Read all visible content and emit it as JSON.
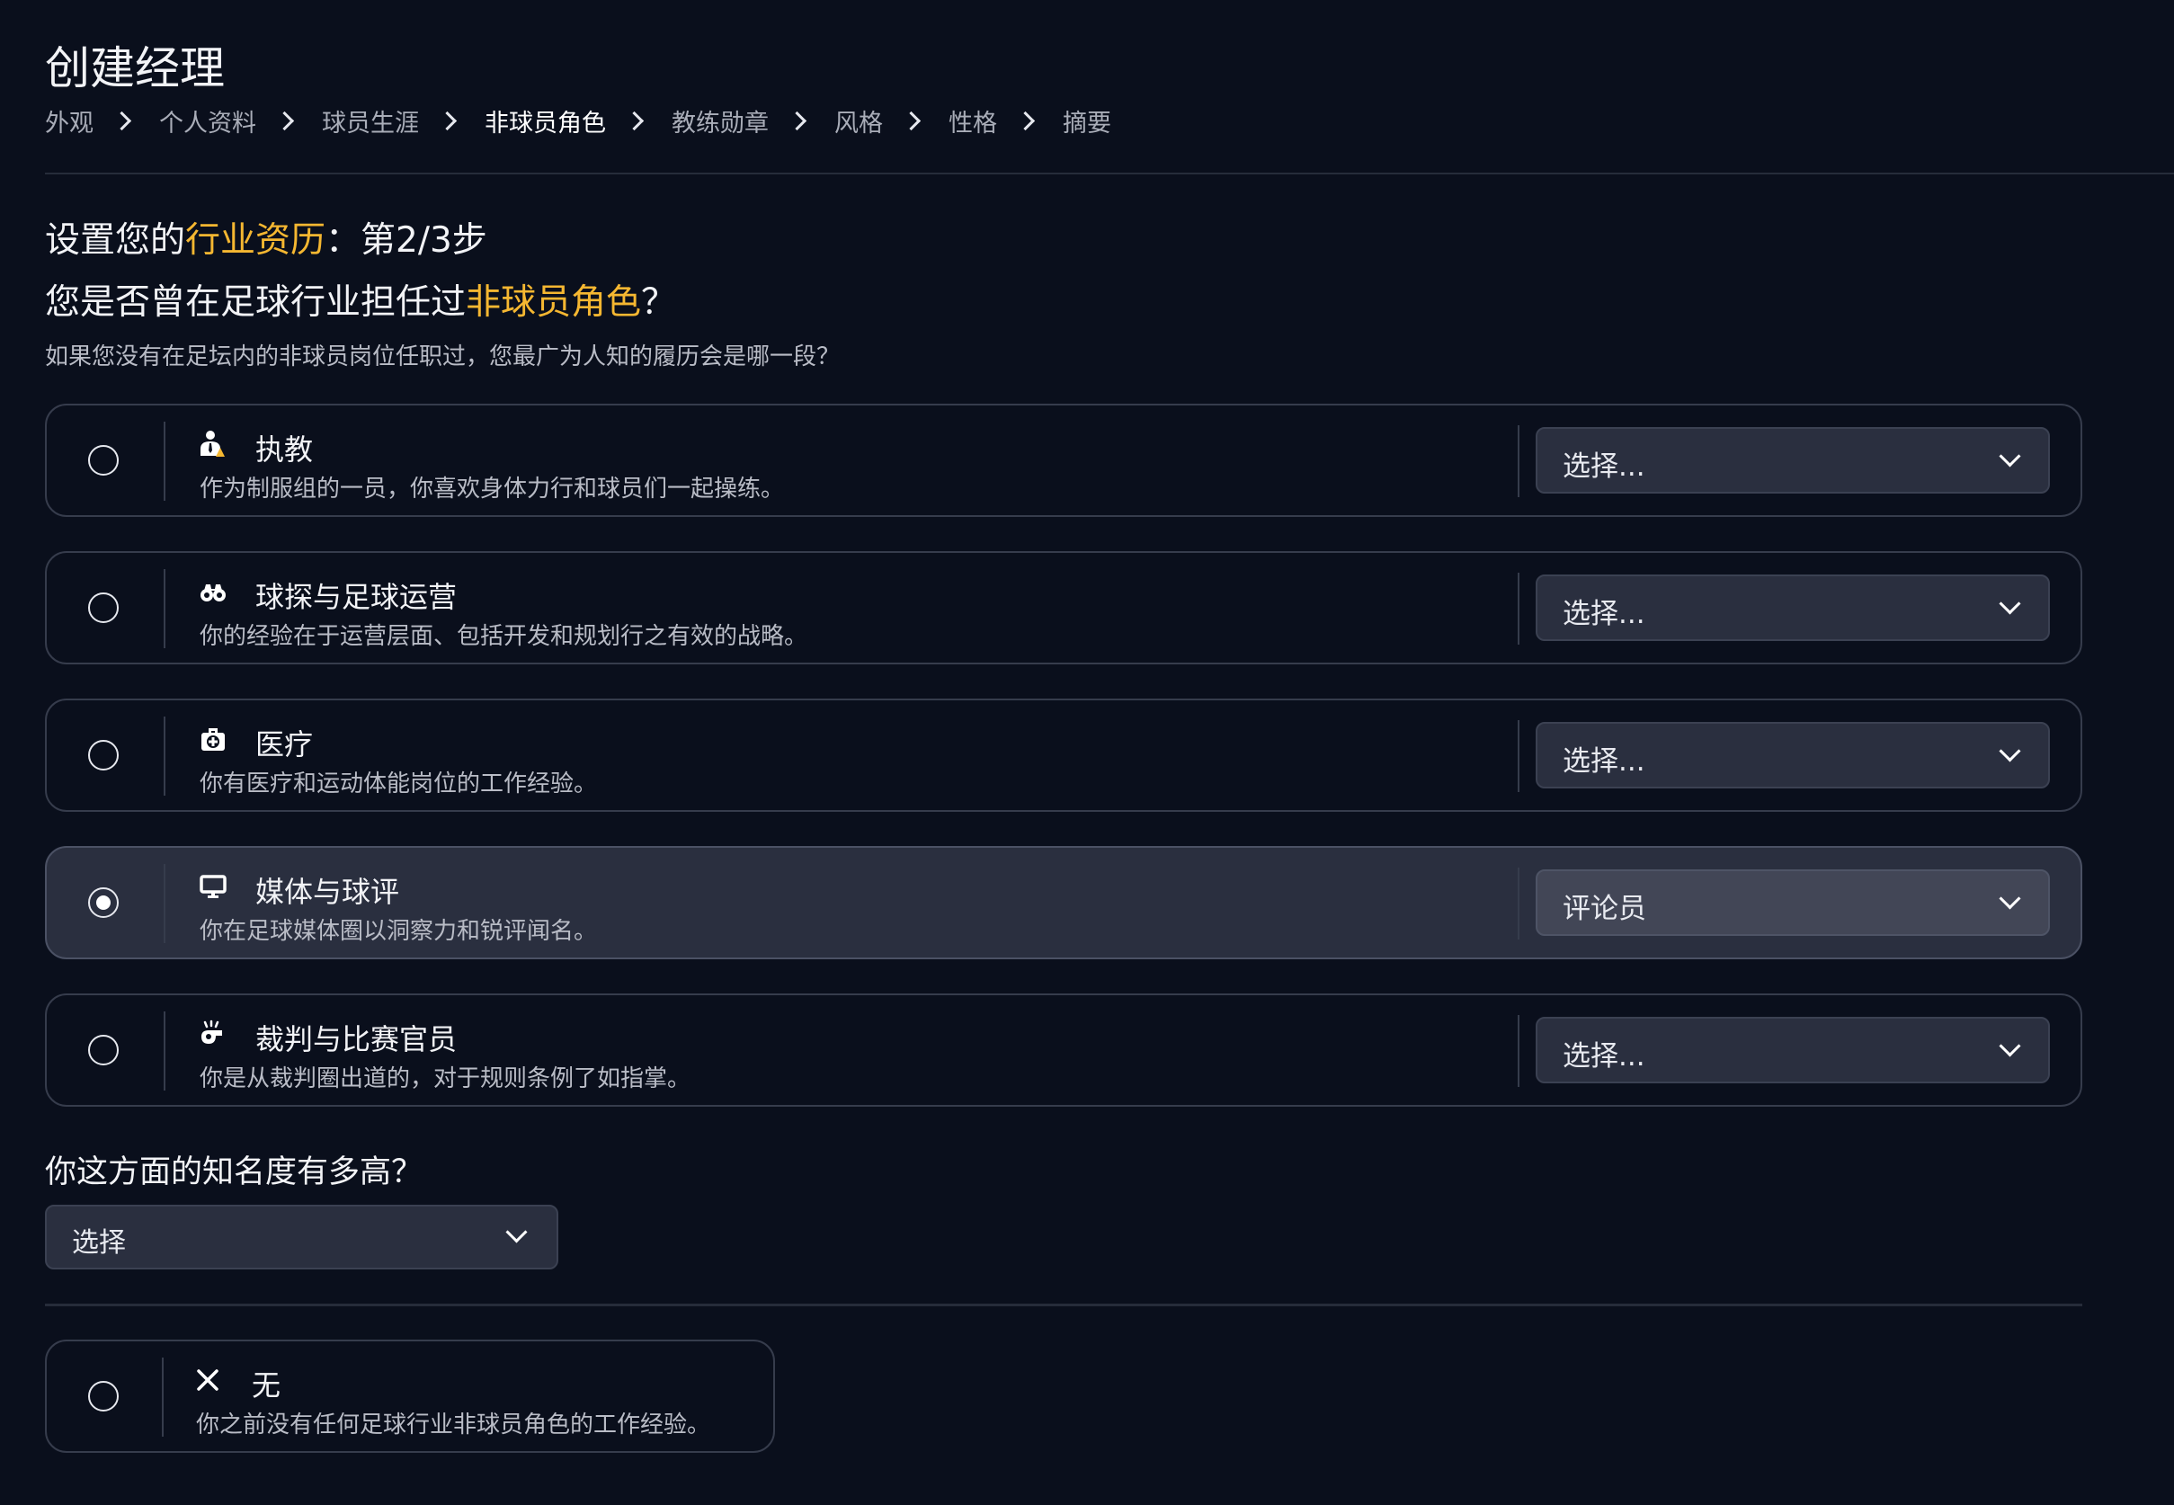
{
  "page": {
    "title": "创建经理"
  },
  "breadcrumb": [
    {
      "label": "外观"
    },
    {
      "label": "个人资料"
    },
    {
      "label": "球员生涯"
    },
    {
      "label": "非球员角色",
      "active": true
    },
    {
      "label": "教练勋章"
    },
    {
      "label": "风格"
    },
    {
      "label": "性格"
    },
    {
      "label": "摘要"
    }
  ],
  "step": {
    "prefix": "设置您的",
    "highlight": "行业资历",
    "suffix": "：第2/3步"
  },
  "question": {
    "prefix": "您是否曾在足球行业担任过",
    "highlight": "非球员角色",
    "suffix": "？",
    "hint": "如果您没有在足坛内的非球员岗位任职过，您最广为人知的履历会是哪一段？"
  },
  "options": [
    {
      "icon": "coach-whistle-icon",
      "title": "执教",
      "desc": "作为制服组的一员，你喜欢身体力行和球员们一起操练。",
      "dropdown": "选择...",
      "selected": false
    },
    {
      "icon": "binoculars-icon",
      "title": "球探与足球运营",
      "desc": "你的经验在于运营层面、包括开发和规划行之有效的战略。",
      "dropdown": "选择...",
      "selected": false
    },
    {
      "icon": "medical-bag-icon",
      "title": "医疗",
      "desc": "你有医疗和运动体能岗位的工作经验。",
      "dropdown": "选择...",
      "selected": false
    },
    {
      "icon": "monitor-icon",
      "title": "媒体与球评",
      "desc": "你在足球媒体圈以洞察力和锐评闻名。",
      "dropdown": "评论员",
      "selected": true
    },
    {
      "icon": "referee-whistle-icon",
      "title": "裁判与比赛官员",
      "desc": "你是从裁判圈出道的，对于规则条例了如指掌。",
      "dropdown": "选择...",
      "selected": false
    }
  ],
  "fame": {
    "label": "你这方面的知名度有多高？",
    "dropdown": "选择"
  },
  "none_option": {
    "icon": "close-x-icon",
    "title": "无",
    "desc": "你之前没有任何足球行业非球员角色的工作经验。",
    "selected": false
  },
  "colors": {
    "background": "#0a0f1c",
    "accent": "#f5b731",
    "card_border": "#363c4c",
    "selected_card": "#2a2f3f"
  }
}
